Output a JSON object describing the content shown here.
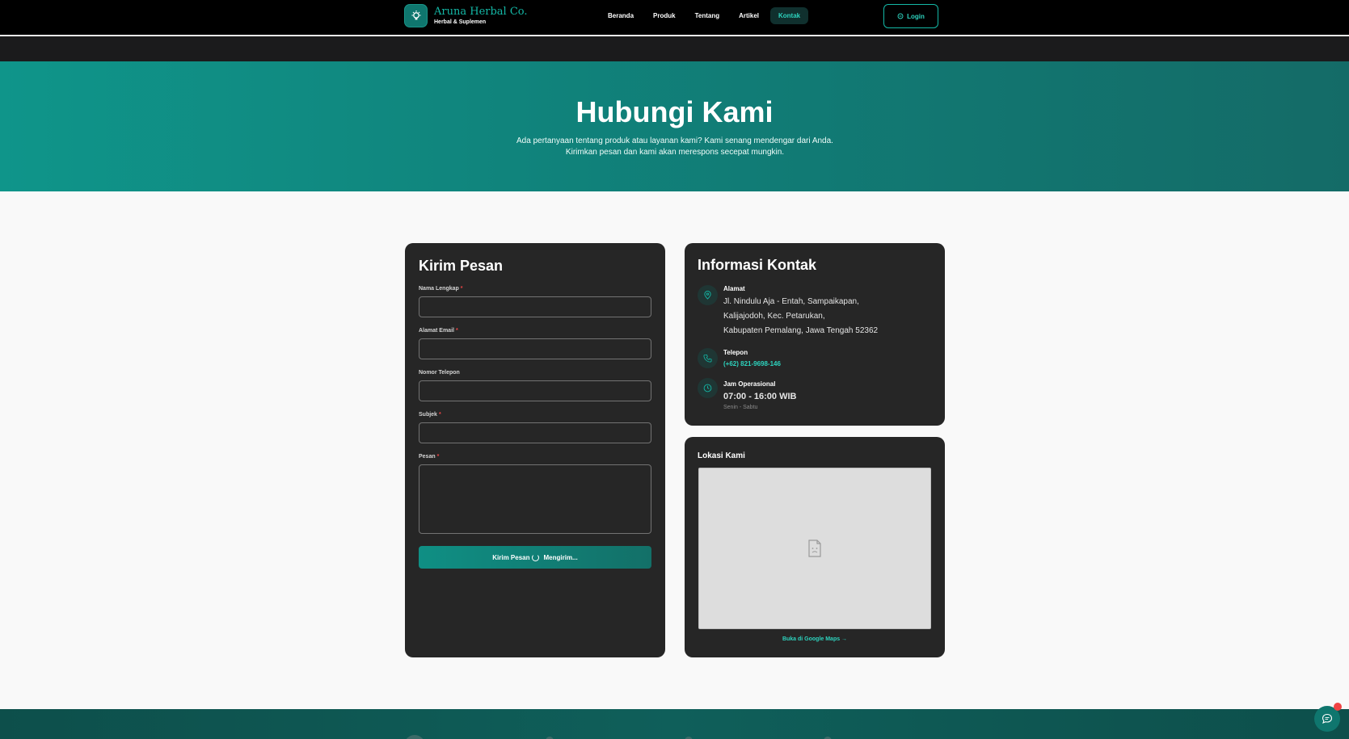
{
  "header": {
    "brand_name": "Aruna Herbal Co.",
    "brand_tagline": "Herbal & Suplemen",
    "nav": [
      "Beranda",
      "Produk",
      "Tentang",
      "Artikel",
      "Kontak"
    ],
    "active_nav": "Kontak",
    "login_label": "Login"
  },
  "hero": {
    "title": "Hubungi Kami",
    "subtitle": "Ada pertanyaan tentang produk atau layanan kami? Kami senang mendengar dari Anda. Kirimkan pesan dan kami akan merespons secepat mungkin."
  },
  "form": {
    "title": "Kirim Pesan",
    "fields": [
      {
        "label": "Nama Lengkap",
        "required": "*",
        "value": ""
      },
      {
        "label": "Alamat Email",
        "required": "*",
        "value": ""
      },
      {
        "label": "Nomor Telepon",
        "required": "",
        "value": ""
      },
      {
        "label": "Subjek",
        "required": "*",
        "value": ""
      },
      {
        "label": "Pesan",
        "required": "*",
        "value": ""
      }
    ],
    "submit_label": "Kirim Pesan",
    "submit_loading": "Mengirim..."
  },
  "contact": {
    "title": "Informasi Kontak",
    "address_label": "Alamat",
    "address_lines": [
      "Jl. Nindulu Aja - Entah, Sampaikapan,",
      "Kalijajodoh, Kec. Petarukan,",
      "Kabupaten Pemalang, Jawa Tengah 52362"
    ],
    "phone_label": "Telepon",
    "phone": "(+62) 821-9698-146",
    "hours_label": "Jam Operasional",
    "hours": "07:00 - 16:00 WIB",
    "days": "Senin - Sabtu"
  },
  "map": {
    "title": "Lokasi Kami",
    "link": "Buka di Google Maps →"
  },
  "colors": {
    "accent": "#14b8a6",
    "hero_start": "#0f958a",
    "card_bg": "#262626",
    "required": "#ef4444"
  }
}
